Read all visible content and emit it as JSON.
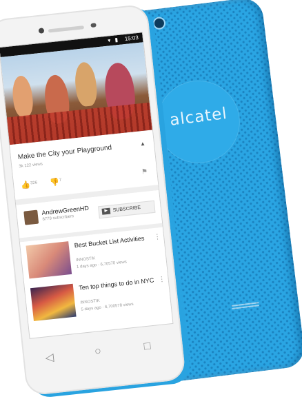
{
  "back": {
    "brand": "alcatel",
    "color": "#2aa5e3"
  },
  "front": {
    "badge": "",
    "color": "#f3f3f3"
  },
  "statusbar": {
    "time": "15:03",
    "icons": "▾ ▮"
  },
  "video": {
    "title": "Make the City your Playground",
    "views": "3k 122 views",
    "like_count": "326",
    "dislike_count": "7"
  },
  "channel": {
    "name": "AndrewGreenHD",
    "subscribers": "8779 subscribers",
    "subscribe_label": "SUBSCRIBE",
    "subscribe_icon": "▶"
  },
  "related": [
    {
      "title": "Best Bucket List Activities",
      "channel": "INNOSTIK",
      "meta": "1 days ago · 6,70570 views",
      "more": "⋮"
    },
    {
      "title": "Ten top things to do in NYC",
      "channel": "INNOSTIK",
      "meta": "5 days ago · 6,700578 views",
      "more": "⋮"
    }
  ],
  "icons": {
    "like": "👍",
    "dislike": "👎",
    "flag": "⚑",
    "caret": "▲",
    "back": "◁",
    "home": "○",
    "recent": "□"
  }
}
